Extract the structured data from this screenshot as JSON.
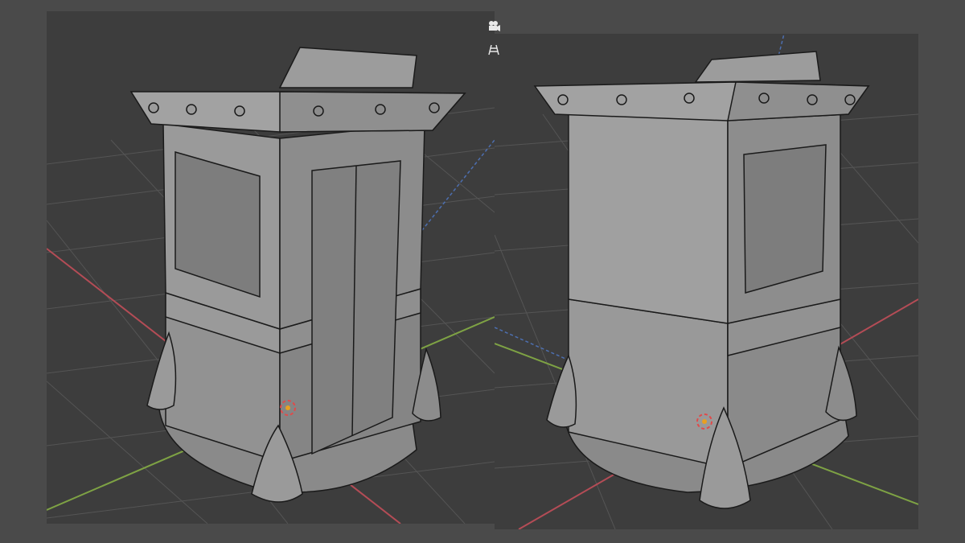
{
  "viewports": [
    {
      "name": "viewport-left",
      "view": "perspective-front-right"
    },
    {
      "name": "viewport-right",
      "view": "perspective-back-left"
    }
  ],
  "gizmos": [
    {
      "name": "camera-icon"
    },
    {
      "name": "perspective-toggle-icon"
    }
  ],
  "colors": {
    "background": "#3d3d3d",
    "frame": "#4a4a4a",
    "grid": "#555555",
    "x_axis": "#b44c56",
    "y_axis": "#7ea244",
    "z_axis": "#4d6fb0",
    "mesh_fill": "#8c8c8c",
    "mesh_edge": "#1a1a1a",
    "cursor": "#e04a4a"
  }
}
